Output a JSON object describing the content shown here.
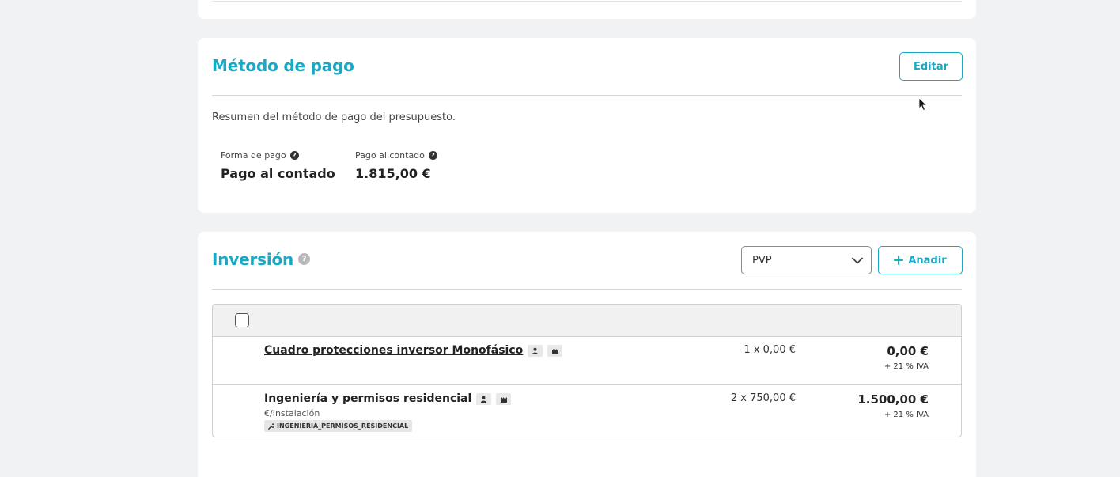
{
  "payment": {
    "title": "Método de pago",
    "edit_label": "Editar",
    "description": "Resumen del método de pago del presupuesto.",
    "fields": [
      {
        "label": "Forma de pago",
        "value": "Pago al contado"
      },
      {
        "label": "Pago al contado",
        "value": "1.815,00 €"
      }
    ]
  },
  "investment": {
    "title": "Inversión",
    "price_select": {
      "value": "PVP"
    },
    "add_label": "Añadir",
    "items": [
      {
        "name": "Cuadro protecciones inversor Monofásico",
        "quantity": "1 x 0,00 €",
        "total": "0,00 €",
        "tax": "+ 21 % IVA"
      },
      {
        "name": "Ingeniería y permisos residencial",
        "unit": "€/Instalación",
        "tag": "INGENIERIA_PERMISOS_RESIDENCIAL",
        "quantity": "2 x 750,00 €",
        "total": "1.500,00 €",
        "tax": "+ 21 % IVA"
      }
    ]
  },
  "colors": {
    "accent": "#19a9c4",
    "background": "#f1f2f3"
  }
}
